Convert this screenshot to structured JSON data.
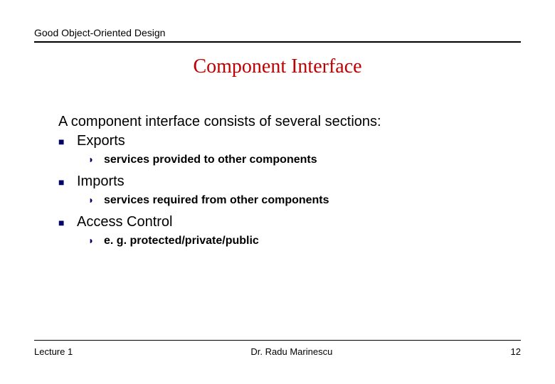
{
  "header": {
    "course": "Good Object-Oriented Design"
  },
  "title": "Component Interface",
  "intro": "A component interface consists of several sections:",
  "items": [
    {
      "label": "Exports",
      "sub": "services provided to other components"
    },
    {
      "label": "Imports",
      "sub": "services required from other components"
    },
    {
      "label": "Access Control",
      "sub": "e. g. protected/private/public"
    }
  ],
  "footer": {
    "left": "Lecture 1",
    "center": "Dr. Radu Marinescu",
    "right": "12"
  },
  "glyphs": {
    "square": "■",
    "arrow": "◗"
  }
}
